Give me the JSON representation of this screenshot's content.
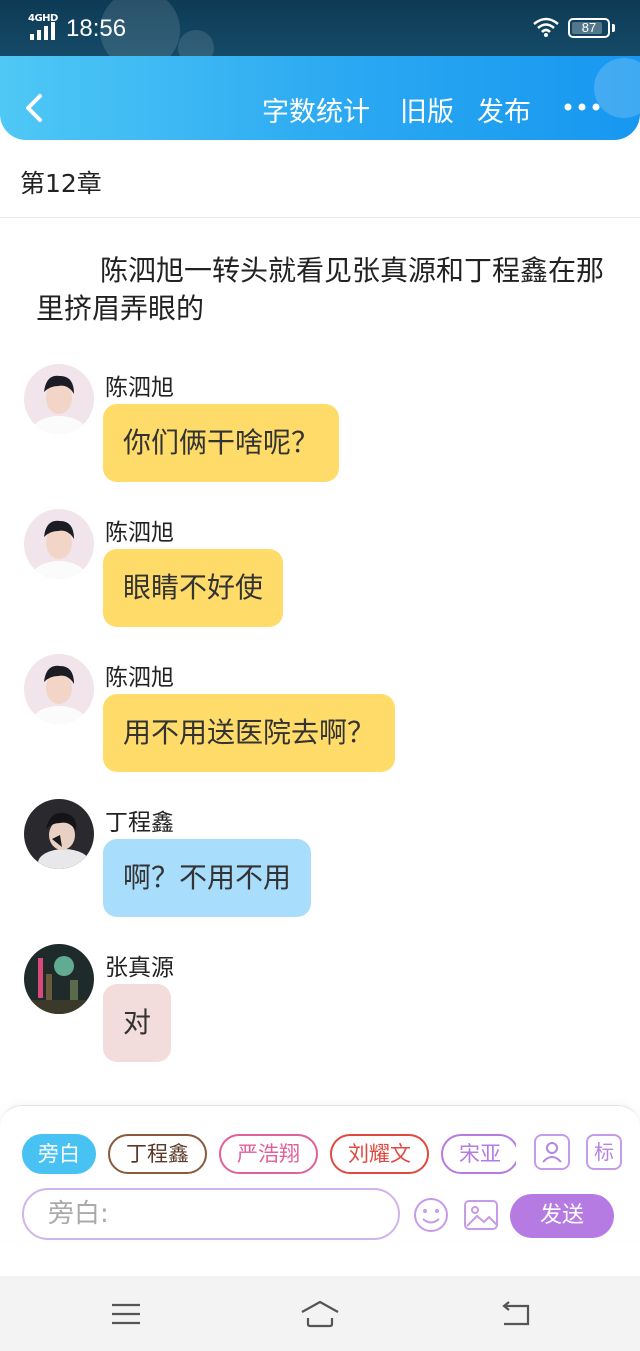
{
  "status_bar": {
    "network": "4GHD",
    "time": "18:56",
    "battery": "87",
    "battery_level": 0.87
  },
  "header": {
    "back_icon": "chevron-left-icon",
    "actions": [
      "字数统计",
      "旧版",
      "发布"
    ],
    "more_icon": "more-dots-icon"
  },
  "chapter": {
    "title": "第12章"
  },
  "narration": "陈泗旭一转头就看见张真源和丁程鑫在那里挤眉弄眼的",
  "messages": [
    {
      "sender": "陈泗旭",
      "text": "你们俩干啥呢？",
      "color": "#ffdc6a"
    },
    {
      "sender": "陈泗旭",
      "text": "眼睛不好使",
      "color": "#ffdc6a"
    },
    {
      "sender": "陈泗旭",
      "text": "用不用送医院去啊？",
      "color": "#ffdc6a"
    },
    {
      "sender": "丁程鑫",
      "text": "啊？不用不用",
      "color": "#a8ddfb"
    },
    {
      "sender": "张真源",
      "text": "对",
      "color": "#f2dcdc"
    }
  ],
  "character_chips": [
    {
      "label": "旁白",
      "color": "#48c2f2",
      "active": true
    },
    {
      "label": "丁程鑫",
      "color": "#8a5a3c",
      "active": false
    },
    {
      "label": "严浩翔",
      "color": "#e0609a",
      "active": false
    },
    {
      "label": "刘耀文",
      "color": "#e0493f",
      "active": false
    },
    {
      "label": "宋亚",
      "color": "#b57be3",
      "active": false
    }
  ],
  "tools": {
    "character_icon": "person-icon",
    "tag_label": "标"
  },
  "input": {
    "placeholder": "旁白:",
    "send_label": "发送"
  },
  "nav": {
    "icons": [
      "menu-icon",
      "home-icon",
      "back-icon"
    ]
  }
}
